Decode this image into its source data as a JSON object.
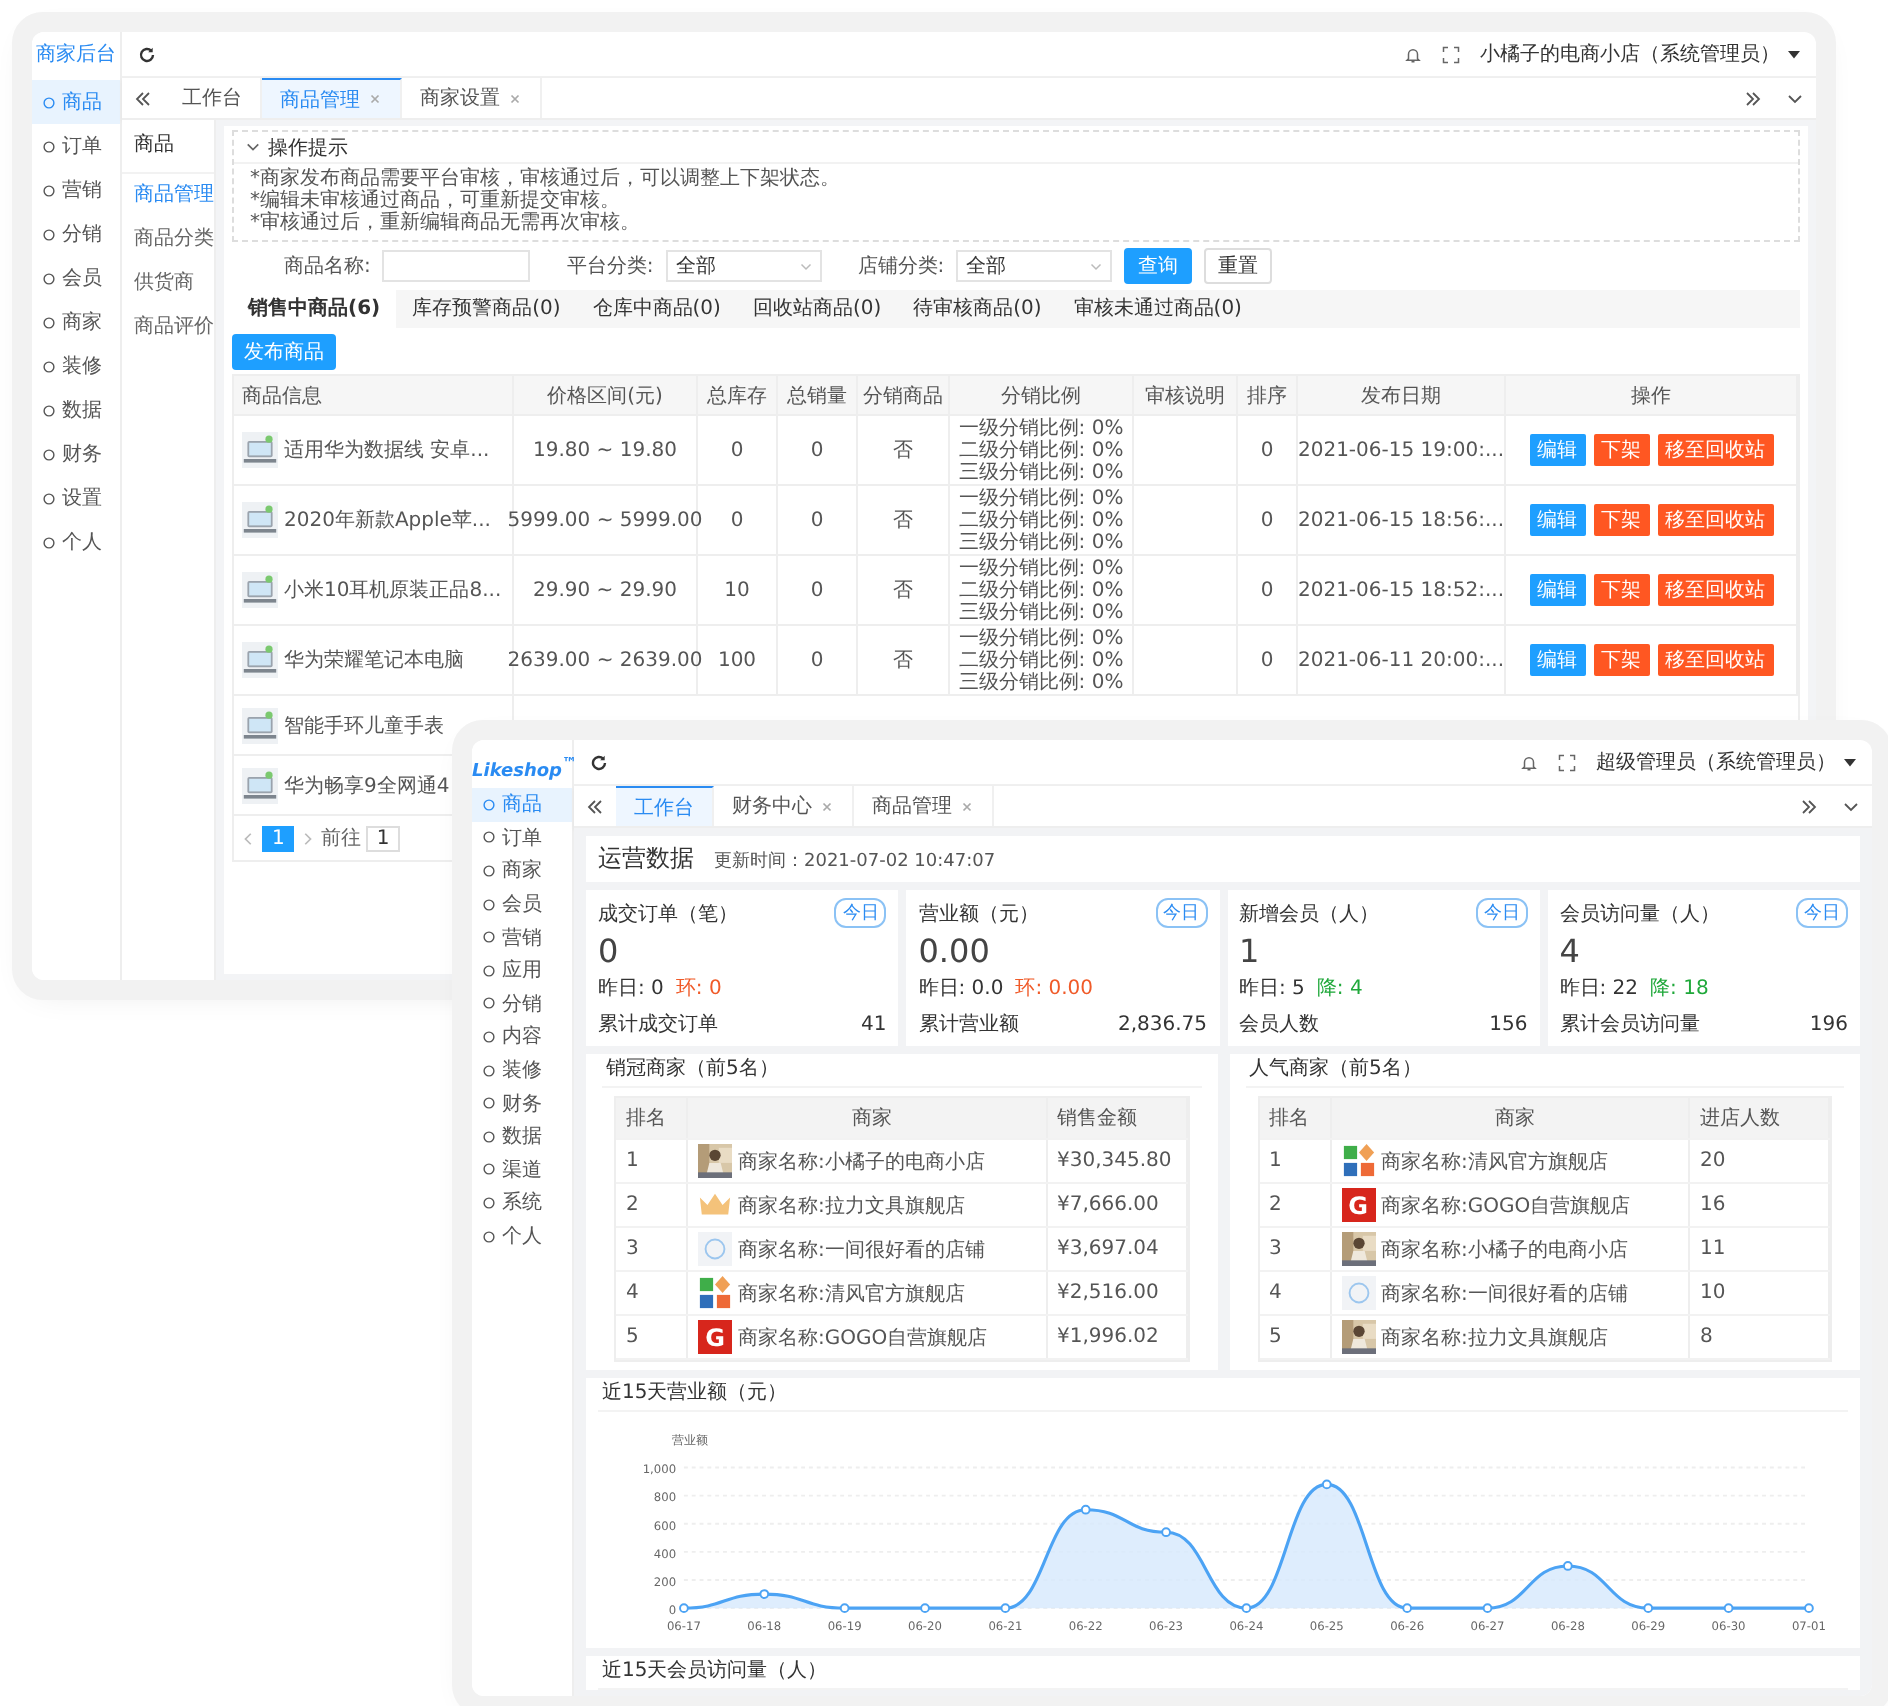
{
  "back_window": {
    "brand": "商家后台",
    "sidebar": [
      {
        "label": "商品",
        "selected": true
      },
      {
        "label": "订单",
        "selected": false
      },
      {
        "label": "营销",
        "selected": false
      },
      {
        "label": "分销",
        "selected": false
      },
      {
        "label": "会员",
        "selected": false
      },
      {
        "label": "商家",
        "selected": false
      },
      {
        "label": "装修",
        "selected": false
      },
      {
        "label": "数据",
        "selected": false
      },
      {
        "label": "财务",
        "selected": false
      },
      {
        "label": "设置",
        "selected": false
      },
      {
        "label": "个人",
        "selected": false
      }
    ],
    "tabs": [
      {
        "label": "工作台",
        "selected": false,
        "closable": false
      },
      {
        "label": "商品管理",
        "selected": true,
        "closable": true
      },
      {
        "label": "商家设置",
        "selected": false,
        "closable": true
      }
    ],
    "user": "小橘子的电商小店（系统管理员）",
    "subnav": {
      "title": "商品",
      "items": [
        {
          "label": "商品管理",
          "selected": true
        },
        {
          "label": "商品分类",
          "selected": false
        },
        {
          "label": "供货商",
          "selected": false
        },
        {
          "label": "商品评价",
          "selected": false
        }
      ]
    },
    "tips": {
      "title": "操作提示",
      "lines": [
        "*商家发布商品需要平台审核，审核通过后，可以调整上下架状态。",
        "*编辑未审核通过商品，可重新提交审核。",
        "*审核通过后，重新编辑商品无需再次审核。"
      ]
    },
    "filters": [
      {
        "kind": "input",
        "label": "商品名称:"
      },
      {
        "kind": "select",
        "label": "平台分类:",
        "value": "全部"
      },
      {
        "kind": "select",
        "label": "店铺分类:",
        "value": "全部"
      }
    ],
    "filter_buttons": [
      {
        "label": "查询",
        "kind": "primary"
      },
      {
        "label": "重置",
        "kind": "plain"
      }
    ],
    "status_tabs": [
      {
        "label": "销售中商品(6)",
        "selected": true
      },
      {
        "label": "库存预警商品(0)",
        "selected": false
      },
      {
        "label": "仓库中商品(0)",
        "selected": false
      },
      {
        "label": "回收站商品(0)",
        "selected": false
      },
      {
        "label": "待审核商品(0)",
        "selected": false
      },
      {
        "label": "审核未通过商品(0)",
        "selected": false
      }
    ],
    "publish_button": "发布商品",
    "table": {
      "columns": [
        "商品信息",
        "价格区间(元)",
        "总库存",
        "总销量",
        "分销商品",
        "分销比例",
        "审核说明",
        "排序",
        "发布日期",
        "操作"
      ],
      "rows": [
        {
          "name": "适用华为数据线 安卓...",
          "price": "19.80 ~ 19.80",
          "stock": "0",
          "sales": "0",
          "distribution": "否",
          "ratios": [
            "一级分销比例: 0%",
            "二级分销比例: 0%",
            "三级分销比例: 0%"
          ],
          "sort": "0",
          "date": "2021-06-15 19:00:...",
          "actions": [
            {
              "label": "编辑",
              "kind": "edit"
            },
            {
              "label": "下架",
              "kind": "danger"
            },
            {
              "label": "移至回收站",
              "kind": "danger"
            }
          ]
        },
        {
          "name": "2020年新款Apple苹...",
          "price": "5999.00 ~ 5999.00",
          "stock": "0",
          "sales": "0",
          "distribution": "否",
          "ratios": [
            "一级分销比例: 0%",
            "二级分销比例: 0%",
            "三级分销比例: 0%"
          ],
          "sort": "0",
          "date": "2021-06-15 18:56:...",
          "actions": [
            {
              "label": "编辑",
              "kind": "edit"
            },
            {
              "label": "下架",
              "kind": "danger"
            },
            {
              "label": "移至回收站",
              "kind": "danger"
            }
          ]
        },
        {
          "name": "小米10耳机原装正品8...",
          "price": "29.90 ~ 29.90",
          "stock": "10",
          "sales": "0",
          "distribution": "否",
          "ratios": [
            "一级分销比例: 0%",
            "二级分销比例: 0%",
            "三级分销比例: 0%"
          ],
          "sort": "0",
          "date": "2021-06-15 18:52:...",
          "actions": [
            {
              "label": "编辑",
              "kind": "edit"
            },
            {
              "label": "下架",
              "kind": "danger"
            },
            {
              "label": "移至回收站",
              "kind": "danger"
            }
          ]
        },
        {
          "name": "华为荣耀笔记本电脑",
          "price": "2639.00 ~ 2639.00",
          "stock": "100",
          "sales": "0",
          "distribution": "否",
          "ratios": [
            "一级分销比例: 0%",
            "二级分销比例: 0%",
            "三级分销比例: 0%"
          ],
          "sort": "0",
          "date": "2021-06-11 20:00:...",
          "actions": [
            {
              "label": "编辑",
              "kind": "edit"
            },
            {
              "label": "下架",
              "kind": "danger"
            },
            {
              "label": "移至回收站",
              "kind": "danger"
            }
          ]
        },
        {
          "name": "智能手环儿童手表"
        },
        {
          "name": "华为畅享9全网通4"
        }
      ]
    },
    "pagination": {
      "pages": [
        {
          "label": "1",
          "selected": true
        }
      ],
      "goto_label": "前往",
      "goto_value": "1"
    }
  },
  "front_window": {
    "brand": "Likeshop$^{™}$",
    "sidebar": [
      {
        "label": "商品",
        "selected": true
      },
      {
        "label": "订单",
        "selected": false
      },
      {
        "label": "商家",
        "selected": false
      },
      {
        "label": "会员",
        "selected": false
      },
      {
        "label": "营销",
        "selected": false
      },
      {
        "label": "应用",
        "selected": false
      },
      {
        "label": "分销",
        "selected": false
      },
      {
        "label": "内容",
        "selected": false
      },
      {
        "label": "装修",
        "selected": false
      },
      {
        "label": "财务",
        "selected": false
      },
      {
        "label": "数据",
        "selected": false
      },
      {
        "label": "渠道",
        "selected": false
      },
      {
        "label": "系统",
        "selected": false
      },
      {
        "label": "个人",
        "selected": false
      }
    ],
    "user": "超级管理员（系统管理员）",
    "tabs": [
      {
        "label": "工作台",
        "selected": true,
        "closable": false
      },
      {
        "label": "财务中心",
        "selected": false,
        "closable": true
      },
      {
        "label": "商品管理",
        "selected": false,
        "closable": true
      }
    ],
    "heading": "运营数据",
    "updated": "更新时间：2021-07-02 10:47:07",
    "cards": [
      {
        "title": "成交订单（笔）",
        "badge": "今日",
        "value": "0",
        "yesterday": "昨日: 0",
        "change": "环: 0",
        "color": "#f05a28",
        "total_label": "累计成交订单",
        "total": "41"
      },
      {
        "title": "营业额（元）",
        "badge": "今日",
        "value": "0.00",
        "yesterday": "昨日: 0.0",
        "change": "环: 0.00",
        "color": "#f05a28",
        "total_label": "累计营业额",
        "total": "2,836.75"
      },
      {
        "title": "新增会员（人）",
        "badge": "今日",
        "value": "1",
        "yesterday": "昨日: 5",
        "change": "降: 4",
        "color": "#1fa83a",
        "total_label": "会员人数",
        "total": "156"
      },
      {
        "title": "会员访问量（人）",
        "badge": "今日",
        "value": "4",
        "yesterday": "昨日: 22",
        "change": "降: 18",
        "color": "#1fa83a",
        "total_label": "累计会员访问量",
        "total": "196"
      }
    ],
    "rankings": [
      {
        "title": "销冠商家（前5名）",
        "columns": [
          "排名",
          "商家",
          "销售金额"
        ],
        "rows": [
          {
            "rank": "1",
            "store": "商家名称:小橘子的电商小店",
            "amount": "¥30,345.80"
          },
          {
            "rank": "2",
            "kind": "crown",
            "store": "商家名称:拉力文具旗舰店",
            "amount": "¥7,666.00"
          },
          {
            "rank": "3",
            "kind": "ring",
            "store": "商家名称:一间很好看的店铺",
            "amount": "¥3,697.04"
          },
          {
            "rank": "4",
            "kind": "blocks",
            "store": "商家名称:清风官方旗舰店",
            "amount": "¥2,516.00"
          },
          {
            "rank": "5",
            "kind": "letter",
            "logo_text": "G",
            "store": "商家名称:GOGO自营旗舰店",
            "amount": "¥1,996.02"
          }
        ]
      },
      {
        "title": "人气商家（前5名）",
        "columns": [
          "排名",
          "商家",
          "进店人数"
        ],
        "rows": [
          {
            "rank": "1",
            "kind": "blocks",
            "store": "商家名称:清风官方旗舰店",
            "amount": "20"
          },
          {
            "rank": "2",
            "kind": "letter",
            "logo_text": "G",
            "store": "商家名称:GOGO自营旗舰店",
            "amount": "16"
          },
          {
            "rank": "3",
            "store": "商家名称:小橘子的电商小店",
            "amount": "11"
          },
          {
            "rank": "4",
            "kind": "ring",
            "store": "商家名称:一间很好看的店铺",
            "amount": "10"
          },
          {
            "rank": "5",
            "store": "商家名称:拉力文具旗舰店",
            "amount": "8"
          }
        ]
      }
    ],
    "chart_panel": {
      "title": "近15天营业额（元）",
      "chart_data": {
        "type": "area",
        "ylabel": "营业额",
        "grid": true,
        "categories": [
          "06-17",
          "06-18",
          "06-19",
          "06-20",
          "06-21",
          "06-22",
          "06-23",
          "06-24",
          "06-25",
          "06-26",
          "06-27",
          "06-28",
          "06-29",
          "06-30",
          "07-01"
        ],
        "values": [
          0,
          100,
          0,
          0,
          0,
          700,
          540,
          0,
          880,
          0,
          0,
          300,
          0,
          0,
          0
        ],
        "ylim": [
          0,
          1000
        ],
        "yticks": [
          {
            "value": 0,
            "label": "0"
          },
          {
            "value": 200,
            "label": "200"
          },
          {
            "value": 400,
            "label": "400"
          },
          {
            "value": 600,
            "label": "600"
          },
          {
            "value": 800,
            "label": "800"
          },
          {
            "value": 1000,
            "label": "1,000"
          }
        ]
      }
    },
    "next_panel_title": "近15天会员访问量（人）"
  }
}
